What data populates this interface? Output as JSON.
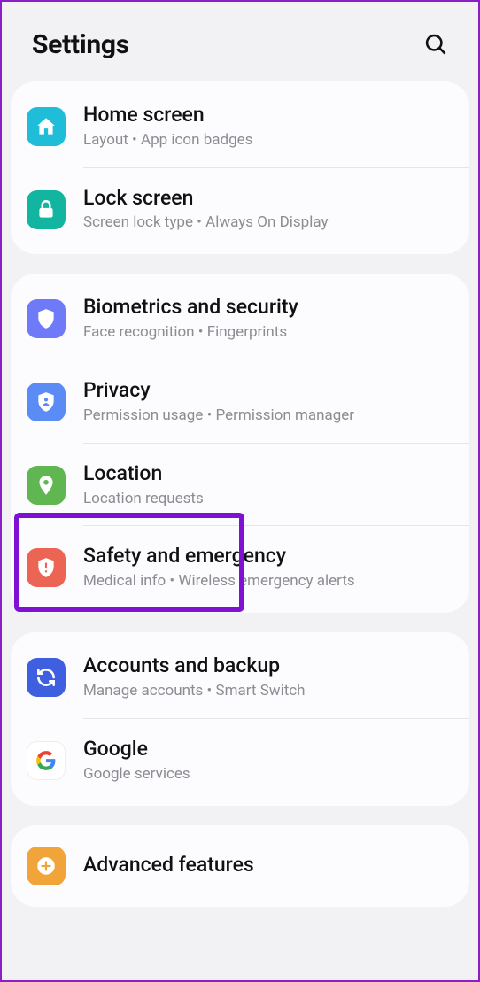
{
  "header": {
    "title": "Settings"
  },
  "groups": [
    {
      "items": [
        {
          "id": "home-screen",
          "icon": "home-icon",
          "iconClass": "ic-home",
          "title": "Home screen",
          "subtitle": "Layout  •  App icon badges"
        },
        {
          "id": "lock-screen",
          "icon": "lock-icon",
          "iconClass": "ic-lock",
          "title": "Lock screen",
          "subtitle": "Screen lock type  •  Always On Display"
        }
      ]
    },
    {
      "items": [
        {
          "id": "biometrics",
          "icon": "shield-icon",
          "iconClass": "ic-bio",
          "title": "Biometrics and security",
          "subtitle": "Face recognition  •  Fingerprints"
        },
        {
          "id": "privacy",
          "icon": "privacy-shield-icon",
          "iconClass": "ic-priv",
          "title": "Privacy",
          "subtitle": "Permission usage  •  Permission manager"
        },
        {
          "id": "location",
          "icon": "location-pin-icon",
          "iconClass": "ic-loc",
          "title": "Location",
          "subtitle": "Location requests"
        },
        {
          "id": "safety",
          "icon": "alert-shield-icon",
          "iconClass": "ic-safe",
          "title": "Safety and emergency",
          "subtitle": "Medical info  •  Wireless emergency alerts"
        }
      ]
    },
    {
      "items": [
        {
          "id": "accounts",
          "icon": "sync-icon",
          "iconClass": "ic-acct",
          "title": "Accounts and backup",
          "subtitle": "Manage accounts  •  Smart Switch"
        },
        {
          "id": "google",
          "icon": "google-g-icon",
          "iconClass": "ic-goog",
          "title": "Google",
          "subtitle": "Google services"
        }
      ]
    },
    {
      "items": [
        {
          "id": "advanced",
          "icon": "plus-square-icon",
          "iconClass": "ic-adv",
          "title": "Advanced features",
          "subtitle": ""
        }
      ]
    }
  ]
}
